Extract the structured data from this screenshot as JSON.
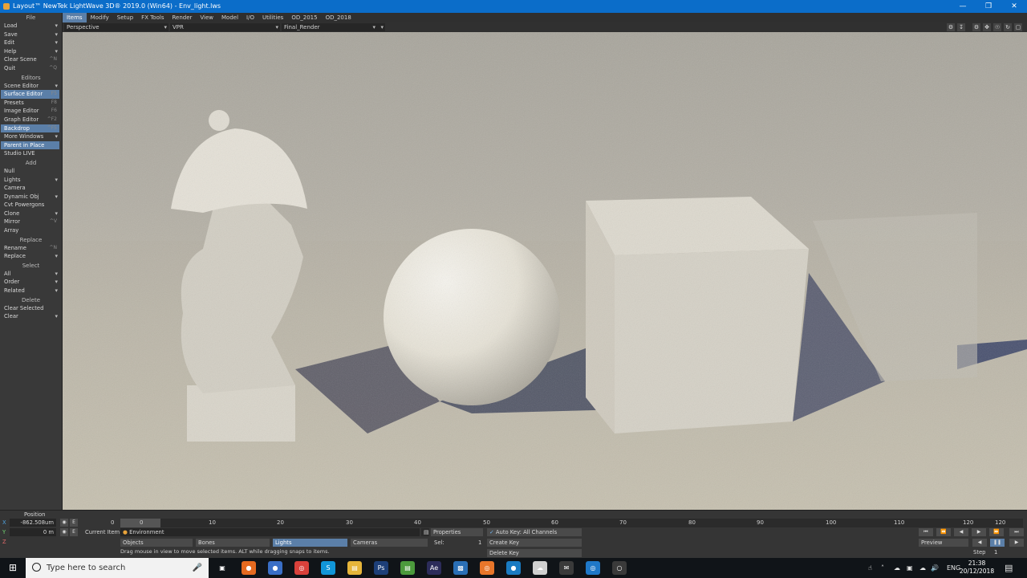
{
  "window": {
    "title": "Layout™ NewTek LightWave 3D® 2019.0 (Win64) - Env_light.lws",
    "controls": [
      "—",
      "❒",
      "✕"
    ]
  },
  "menubar": {
    "tabs": [
      "Items",
      "Modify",
      "Setup",
      "FX Tools",
      "Render",
      "View",
      "Model",
      "I/O",
      "Utilities",
      "OD_2015",
      "OD_2018"
    ],
    "active": "Items"
  },
  "viewbar": {
    "view_mode": "Perspective",
    "render_mode": "VPR",
    "render_preset": "Final_Render"
  },
  "sidebar": {
    "sections": [
      {
        "header": "File",
        "items": [
          {
            "label": "Load",
            "arrow": true
          },
          {
            "label": "Save",
            "arrow": true
          },
          {
            "label": "Edit",
            "arrow": true
          },
          {
            "label": "Help",
            "arrow": true
          },
          {
            "label": "Clear Scene",
            "key": "^N"
          },
          {
            "label": "Quit",
            "key": "^Q"
          }
        ]
      },
      {
        "header": "Editors",
        "items": [
          {
            "label": "Scene Editor",
            "arrow": true
          },
          {
            "label": "Surface Editor",
            "key": "F5",
            "selected": true
          },
          {
            "label": "Presets",
            "key": "F8"
          },
          {
            "label": "Image Editor",
            "key": "F6"
          },
          {
            "label": "Graph Editor",
            "key": "^F2"
          },
          {
            "label": "Backdrop",
            "key": "^F5",
            "selected": true
          },
          {
            "label": "More Windows",
            "arrow": true
          },
          {
            "label": "Parent in Place",
            "selected": true
          },
          {
            "label": "Studio LIVE"
          }
        ]
      },
      {
        "header": "Add",
        "items": [
          {
            "label": "Null"
          },
          {
            "label": "Lights",
            "arrow": true
          },
          {
            "label": "Camera"
          },
          {
            "label": "Dynamic Obj",
            "arrow": true
          },
          {
            "label": "Cvt Powergons"
          },
          {
            "label": "Clone",
            "arrow": true
          },
          {
            "label": "Mirror",
            "key": "^V"
          },
          {
            "label": "Array"
          }
        ]
      },
      {
        "header": "Replace",
        "items": [
          {
            "label": "Rename",
            "key": "^N"
          },
          {
            "label": "Replace",
            "arrow": true
          }
        ]
      },
      {
        "header": "Select",
        "items": [
          {
            "label": "All",
            "arrow": true
          },
          {
            "label": "Order",
            "arrow": true
          },
          {
            "label": "Related",
            "arrow": true
          }
        ]
      },
      {
        "header": "Delete",
        "items": [
          {
            "label": "Clear Selected"
          },
          {
            "label": "Clear",
            "arrow": true
          }
        ]
      }
    ]
  },
  "timeline": {
    "position_label": "Position",
    "x_label": "X",
    "x_value": "-862.508um",
    "y_label": "Y",
    "y_value": "0 m",
    "z_label": "Z",
    "e_label": "E",
    "ticks": [
      "0",
      "0",
      "10",
      "20",
      "30",
      "40",
      "50",
      "60",
      "70",
      "80",
      "90",
      "100",
      "110",
      "120",
      "120"
    ],
    "current_item_label": "Current Item",
    "current_item": "Environment",
    "objects_label": "Objects",
    "bones_label": "Bones",
    "lights_label": "Lights",
    "cameras_label": "Cameras",
    "properties_label": "Properties",
    "sel_label": "Sel:",
    "sel_value": "1",
    "auto_key": "Auto Key: All Channels",
    "create_key": "Create Key",
    "delete_key": "Delete Key",
    "preview": "Preview",
    "step_label": "Step",
    "step_value": "1",
    "status": "Drag mouse in view to move selected items. ALT while dragging snaps to items."
  },
  "taskbar": {
    "search_placeholder": "Type here to search",
    "language": "ENG",
    "time": "21:38",
    "date": "20/12/2018",
    "apps": [
      {
        "name": "task-view-icon",
        "color": "#101418",
        "glyph": "▣"
      },
      {
        "name": "firefox-icon",
        "color": "#e66a1f",
        "glyph": "●"
      },
      {
        "name": "app-sphere-icon",
        "color": "#3a6fc7",
        "glyph": "●"
      },
      {
        "name": "chrome-icon",
        "color": "#d9413b",
        "glyph": "◎"
      },
      {
        "name": "skype-icon",
        "color": "#1196d8",
        "glyph": "S"
      },
      {
        "name": "file-explorer-icon",
        "color": "#e6b53a",
        "glyph": "▤"
      },
      {
        "name": "photoshop-icon",
        "color": "#1d3f78",
        "glyph": "Ps"
      },
      {
        "name": "notepad-icon",
        "color": "#4c9a3c",
        "glyph": "▤"
      },
      {
        "name": "after-effects-icon",
        "color": "#2c2c5a",
        "glyph": "Ae"
      },
      {
        "name": "photos-icon",
        "color": "#2a6fb5",
        "glyph": "▩"
      },
      {
        "name": "blender-icon",
        "color": "#e8762a",
        "glyph": "◎"
      },
      {
        "name": "app-blue-icon",
        "color": "#1a7bc2",
        "glyph": "●"
      },
      {
        "name": "cloud-app-icon",
        "color": "#d0d0d0",
        "glyph": "☁"
      },
      {
        "name": "mail-icon",
        "color": "#3a3a3a",
        "glyph": "✉"
      },
      {
        "name": "lightwave-icon",
        "color": "#1f78c8",
        "glyph": "◎"
      },
      {
        "name": "app-globe-icon",
        "color": "#3a3a3a",
        "glyph": "○"
      }
    ]
  }
}
